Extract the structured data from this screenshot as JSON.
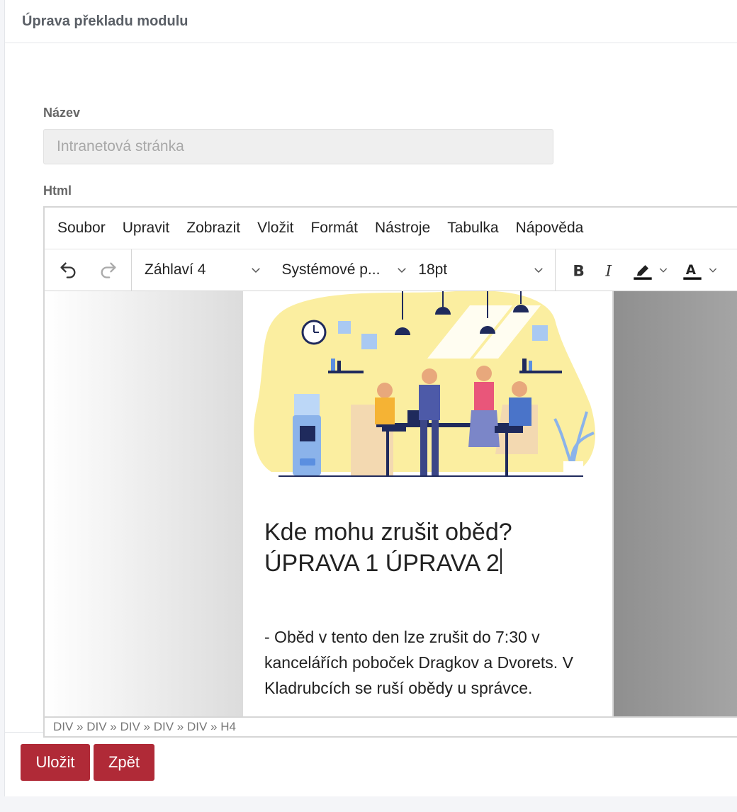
{
  "page": {
    "title": "Úprava překladu modulu"
  },
  "form": {
    "name_label": "Název",
    "name_value": "Intranetová stránka",
    "html_label": "Html"
  },
  "editor": {
    "menu": [
      "Soubor",
      "Upravit",
      "Zobrazit",
      "Vložit",
      "Formát",
      "Nástroje",
      "Tabulka",
      "Nápověda"
    ],
    "toolbar": {
      "block_format": "Záhlaví 4",
      "font_family": "Systémové p...",
      "font_size": "18pt"
    },
    "content": {
      "heading": "Kde mohu zrušit oběd? ÚPRAVA 1 ÚPRAVA 2",
      "paragraph": "- Oběd v tento den lze zrušit do 7:30 v kancelářích poboček Dragkov a Dvorets. V Kladrubcích se ruší obědy u správce."
    },
    "path": "DIV » DIV » DIV » DIV » DIV » H4"
  },
  "actions": {
    "save": "Uložit",
    "back": "Zpět"
  },
  "colors": {
    "primary": "#b02a37",
    "illustration_bg": "#fbeea0",
    "navy": "#1f2a5c"
  }
}
